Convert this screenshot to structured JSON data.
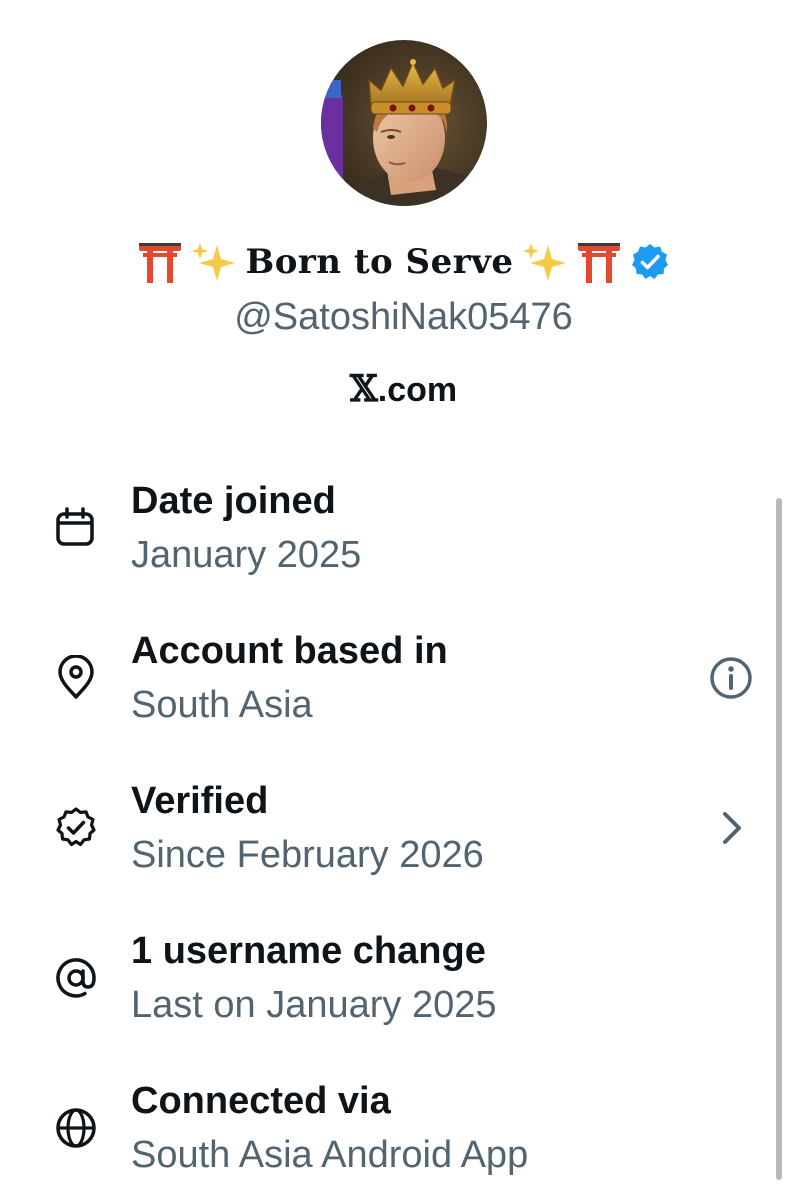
{
  "profile": {
    "display_name": "Born to Serve",
    "handle": "@SatoshiNak05476",
    "site_prefix": "𝕏",
    "site_suffix": ".com",
    "verified": true,
    "badge_color": "#1d9bf0"
  },
  "info_rows": [
    {
      "icon": "calendar-icon",
      "title": "Date joined",
      "value": "January 2025"
    },
    {
      "icon": "location-pin-icon",
      "title": "Account based in",
      "value": "South Asia",
      "action_icon": "info-icon"
    },
    {
      "icon": "verified-check-icon",
      "title": "Verified",
      "value": "Since February 2026",
      "action_icon": "chevron-right-icon"
    },
    {
      "icon": "at-sign-icon",
      "title": "1 username change",
      "value": "Last on January 2025"
    },
    {
      "icon": "globe-icon",
      "title": "Connected via",
      "value": "South Asia Android App"
    }
  ],
  "colors": {
    "primary_text": "#0f1419",
    "secondary_text": "#536471",
    "verified_blue": "#1d9bf0"
  }
}
